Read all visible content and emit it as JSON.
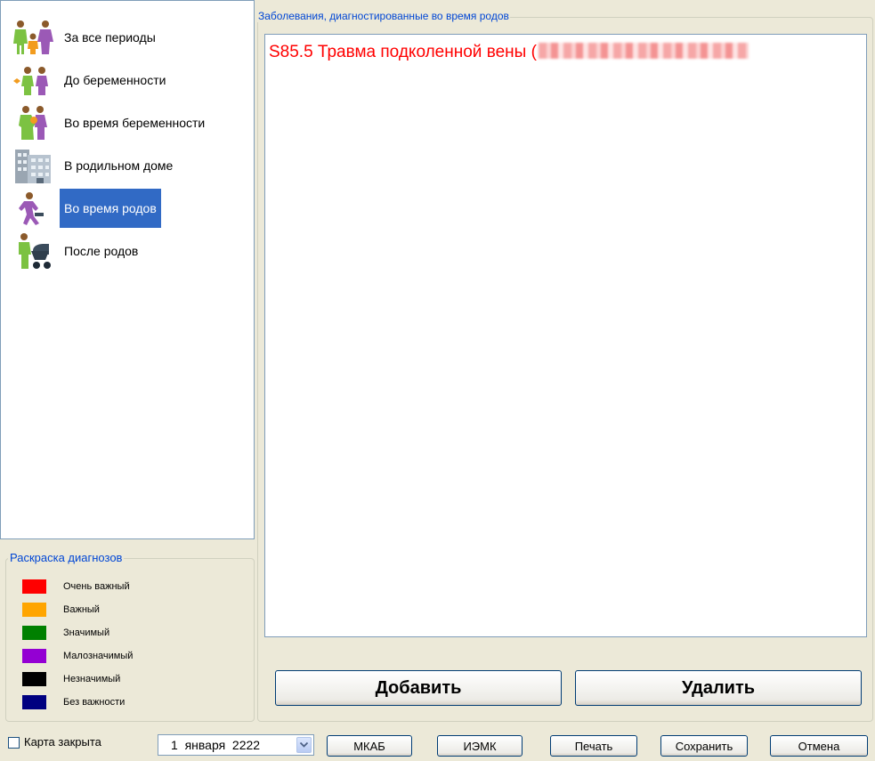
{
  "periods": [
    {
      "label": "За все периоды",
      "icon": "family-icon"
    },
    {
      "label": "До беременности",
      "icon": "couple-icon"
    },
    {
      "label": "Во время беременности",
      "icon": "pregnant-woman-icon"
    },
    {
      "label": "В родильном доме",
      "icon": "hospital-building-icon"
    },
    {
      "label": "Во время родов",
      "icon": "running-woman-icon",
      "selected": true
    },
    {
      "label": "После родов",
      "icon": "woman-with-stroller-icon"
    }
  ],
  "legend": {
    "title": "Раскраска диагнозов",
    "items": [
      {
        "label": "Очень важный",
        "color": "#ff0000"
      },
      {
        "label": "Важный",
        "color": "#ffa500"
      },
      {
        "label": "Значимый",
        "color": "#008000"
      },
      {
        "label": "Малозначимый",
        "color": "#9400d3"
      },
      {
        "label": "Незначимый",
        "color": "#000000"
      },
      {
        "label": "Без важности",
        "color": "#000080"
      }
    ]
  },
  "diagnoses": {
    "title": "Заболевания, диагностированные во время родов",
    "entries": [
      {
        "text": "S85.5 Травма подколенной вены (",
        "color": "#ff0000"
      }
    ]
  },
  "actions": {
    "add": "Добавить",
    "delete": "Удалить"
  },
  "bottom": {
    "card_closed_label": "Карта закрыта",
    "card_closed_checked": false,
    "date_value": "1  января  2222",
    "buttons": [
      "МКАБ",
      "ИЭМК",
      "Печать",
      "Сохранить",
      "Отмена"
    ]
  }
}
